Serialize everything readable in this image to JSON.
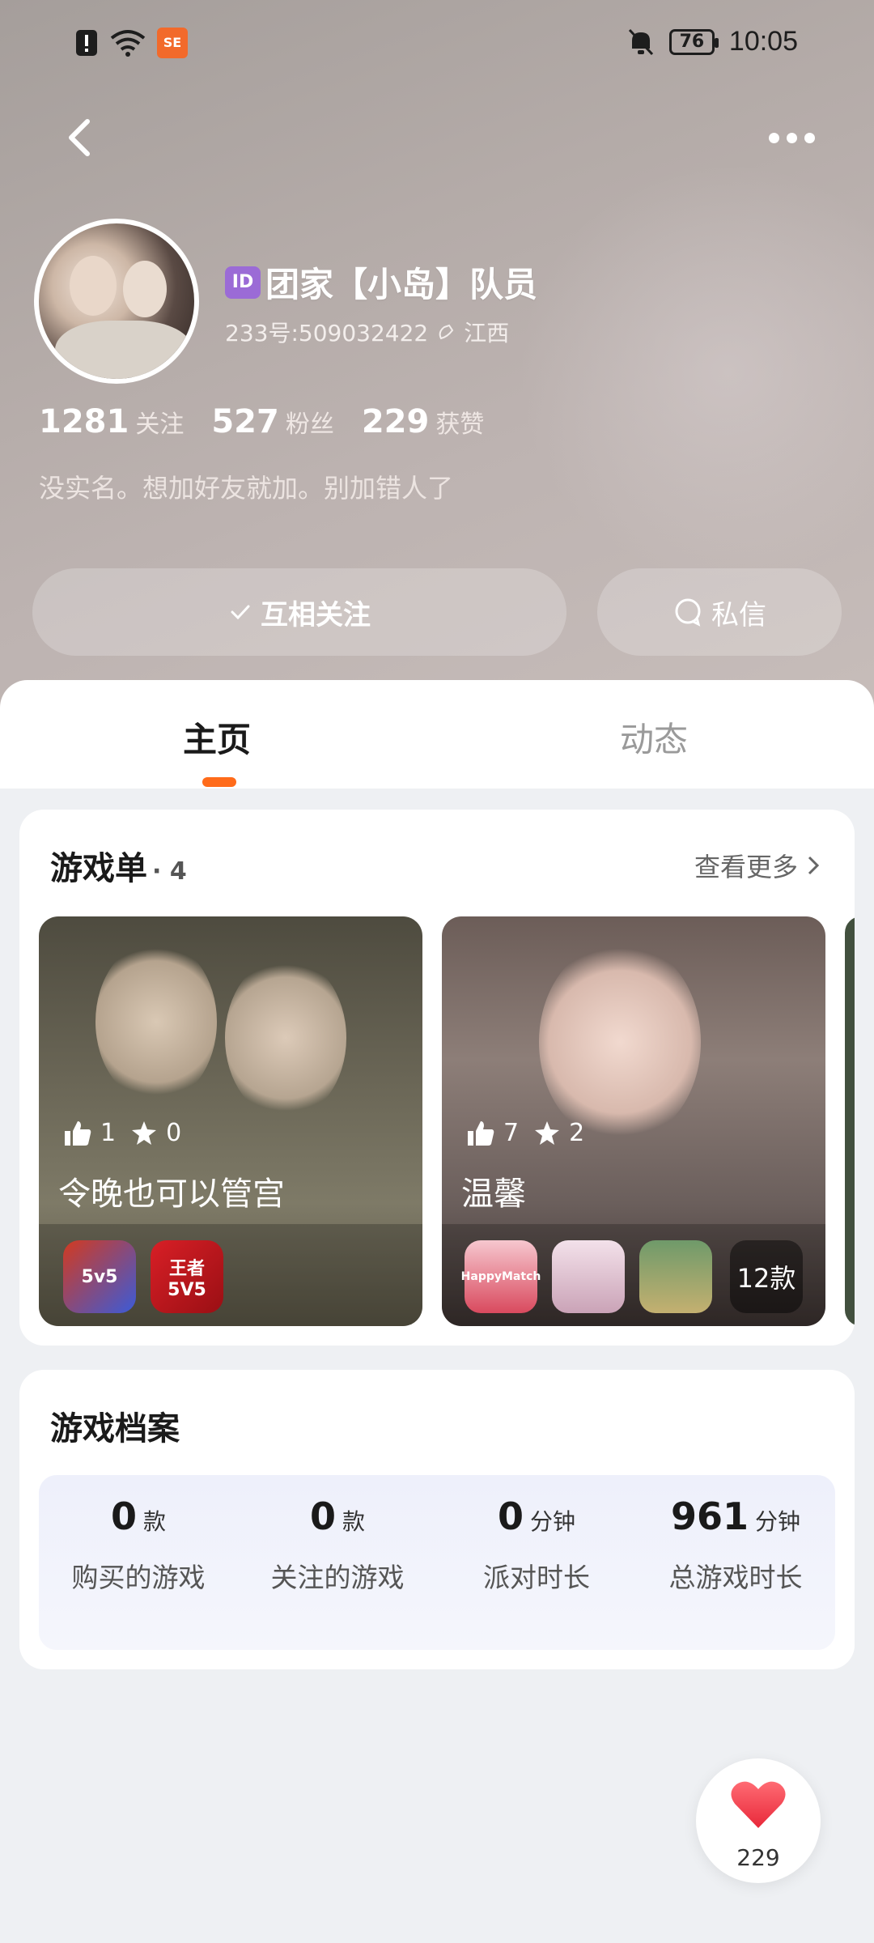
{
  "status_bar": {
    "time": "10:05",
    "battery": "76"
  },
  "profile": {
    "id_badge": "ID",
    "name": "团家【小岛】队员",
    "number": "233号:509032422",
    "location": "江西",
    "stats": [
      {
        "num": "1281",
        "label": "关注"
      },
      {
        "num": "527",
        "label": "粉丝"
      },
      {
        "num": "229",
        "label": "获赞"
      }
    ],
    "bio": "没实名。想加好友就加。别加错人了",
    "follow_label": "互相关注",
    "message_label": "私信"
  },
  "tabs": [
    {
      "label": "主页",
      "active": true
    },
    {
      "label": "动态",
      "active": false
    }
  ],
  "game_lists": {
    "title": "游戏单",
    "count": "· 4",
    "see_more": "查看更多",
    "items": [
      {
        "likes": "1",
        "stars": "0",
        "name": "令晚也可以管宫",
        "icons": [
          "5v5",
          "王者5V5"
        ]
      },
      {
        "likes": "7",
        "stars": "2",
        "name": "温馨",
        "icons": [
          "HappyMatch",
          "",
          ""
        ],
        "more": "12款"
      }
    ]
  },
  "game_profile": {
    "title": "游戏档案",
    "items": [
      {
        "num": "0",
        "unit": "款",
        "label": "购买的游戏"
      },
      {
        "num": "0",
        "unit": "款",
        "label": "关注的游戏"
      },
      {
        "num": "0",
        "unit": "分钟",
        "label": "派对时长"
      },
      {
        "num": "961",
        "unit": "分钟",
        "label": "总游戏时长"
      }
    ]
  },
  "float_like": {
    "count": "229"
  },
  "colors": {
    "accent": "#ff6b1a",
    "heart": "#f0424e",
    "id_badge": "#9b6bd6"
  }
}
